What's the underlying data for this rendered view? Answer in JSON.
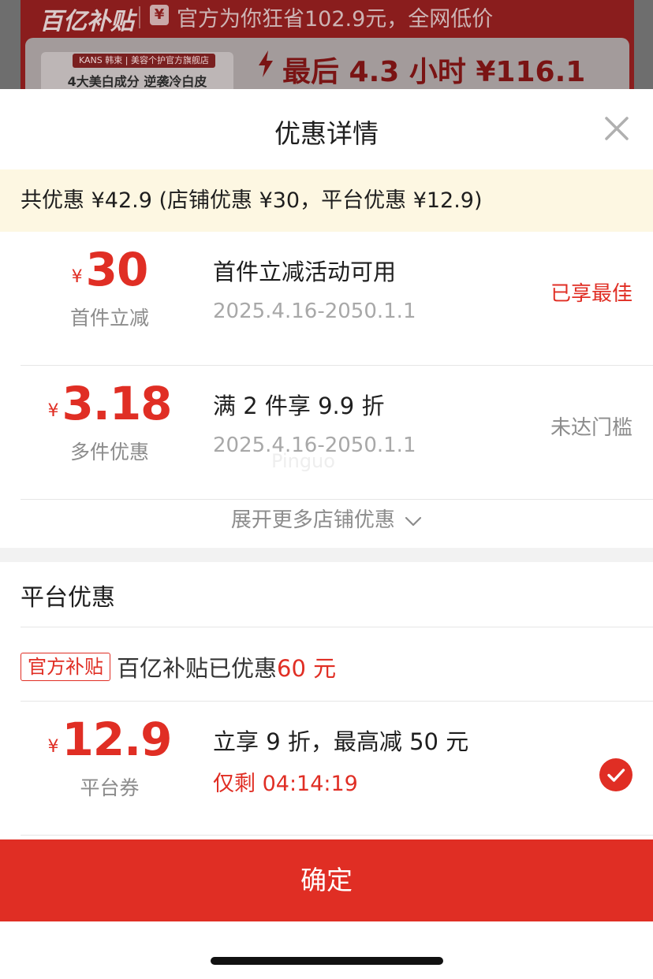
{
  "background": {
    "logo": "百亿补贴",
    "yen_badge": "¥",
    "banner_text": "官方为你狂省102.9元，全网低价",
    "brand_label": "KANS 韩束 | 美容个护官方旗舰店",
    "slogan": "4大美白成分 逆袭冷白皮",
    "countdown_text": "最后 4.3 小时 ¥116.1"
  },
  "sheet": {
    "title": "优惠详情",
    "summary": "共优惠 ¥42.9 (店铺优惠 ¥30，平台优惠 ¥12.9)"
  },
  "shop_offers": [
    {
      "currency": "¥",
      "amount": "30",
      "label": "首件立减",
      "title": "首件立减活动可用",
      "date": "2025.4.16-2050.1.1",
      "status": "已享最佳"
    },
    {
      "currency": "¥",
      "amount": "3.18",
      "label": "多件优惠",
      "title": "满 2 件享 9.9 折",
      "date": "2025.4.16-2050.1.1",
      "status": "未达门槛"
    }
  ],
  "watermark": "Pinguo",
  "expand_label": "展开更多店铺优惠",
  "platform": {
    "section_title": "平台优惠",
    "subsidy_tag": "官方补贴",
    "subsidy_text": "百亿补贴已优惠",
    "subsidy_amount": "60 元",
    "coupon": {
      "currency": "¥",
      "amount": "12.9",
      "label": "平台券",
      "title": "立享 9 折，最高减 50 元",
      "countdown": "仅剩 04:14:19",
      "selected": true
    }
  },
  "confirm_label": "确定",
  "colors": {
    "accent": "#e02e24",
    "summary_bg": "#fdf7e2"
  }
}
